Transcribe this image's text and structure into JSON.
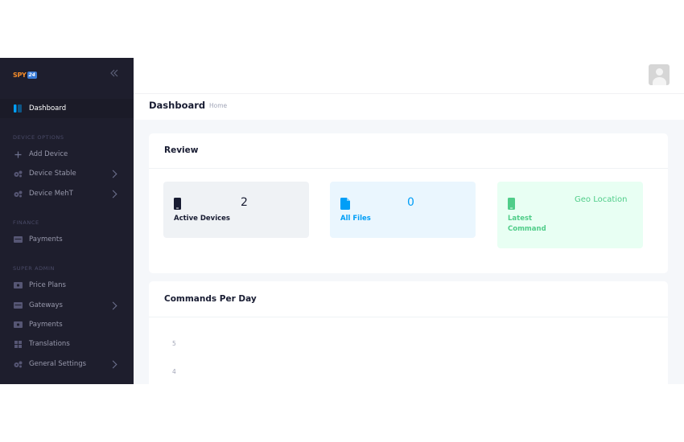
{
  "brand": {
    "logo_text": "SPY",
    "logo_number": "24"
  },
  "sidebar": {
    "items": {
      "dashboard": "Dashboard",
      "add_device": "Add Device",
      "device_stable": "Device Stable",
      "device_meht": "Device MehT",
      "payments_finance": "Payments",
      "price_plans": "Price Plans",
      "gateways": "Gateways",
      "payments_admin": "Payments",
      "translations": "Translations",
      "general_settings": "General Settings"
    },
    "sections": {
      "device_options": "DEVICE OPTIONS",
      "finance": "FINANCE",
      "super_admin": "SUPER ADMIN"
    }
  },
  "header": {
    "title": "Dashboard",
    "breadcrumb": "Home"
  },
  "review": {
    "title": "Review",
    "tiles": {
      "active_devices": {
        "label": "Active Devices",
        "value": "2"
      },
      "all_files": {
        "label": "All Files",
        "value": "0"
      },
      "latest_command": {
        "label_line1": "Latest",
        "label_line2": "Command",
        "value": "Geo Location"
      }
    }
  },
  "commands_chart": {
    "title": "Commands Per Day",
    "y_ticks": [
      "5",
      "4"
    ]
  },
  "colors": {
    "sidebar_bg": "#1e1e2d",
    "accent_blue": "#009ef7",
    "accent_green": "#50cd89",
    "logo_orange": "#f48c2a"
  },
  "icons": {
    "collapse": "double-chevron-left-icon",
    "dashboard": "dashboard-icon",
    "add": "plus-icon",
    "devices": "gears-icon",
    "payments": "money-icon",
    "translations": "grid-icon",
    "phone": "phone-icon",
    "file": "file-icon"
  }
}
